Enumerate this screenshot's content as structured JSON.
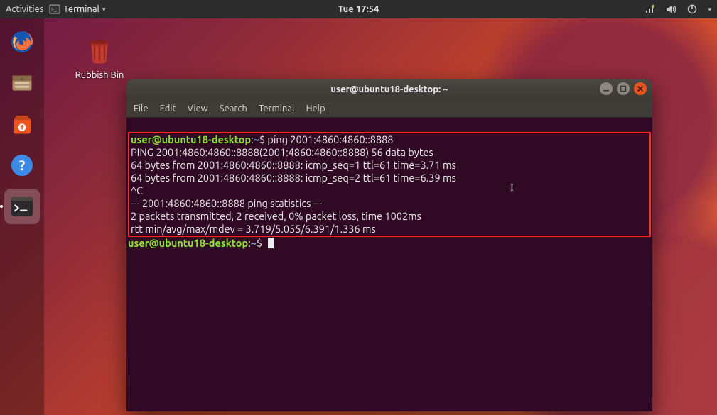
{
  "topbar": {
    "activities": "Activities",
    "app_label": "Terminal",
    "clock": "Tue 17:54"
  },
  "desktop": {
    "trash_label": "Rubbish Bin"
  },
  "window": {
    "title": "user@ubuntu18-desktop: ~",
    "menus": [
      "File",
      "Edit",
      "View",
      "Search",
      "Terminal",
      "Help"
    ]
  },
  "prompt": {
    "user": "user",
    "at": "@",
    "host": "ubuntu18-desktop",
    "colon": ":",
    "path": "~",
    "sigil": "$"
  },
  "cmd": {
    "ping_cmd": "ping 2001:4860:4860::8888"
  },
  "output": {
    "l1": "PING 2001:4860:4860::8888(2001:4860:4860::8888) 56 data bytes",
    "l2": "64 bytes from 2001:4860:4860::8888: icmp_seq=1 ttl=61 time=3.71 ms",
    "l3": "64 bytes from 2001:4860:4860::8888: icmp_seq=2 ttl=61 time=6.39 ms",
    "l4": "^C",
    "l5": "--- 2001:4860:4860::8888 ping statistics ---",
    "l6": "2 packets transmitted, 2 received, 0% packet loss, time 1002ms",
    "l7": "rtt min/avg/max/mdev = 3.719/5.055/6.391/1.336 ms"
  }
}
